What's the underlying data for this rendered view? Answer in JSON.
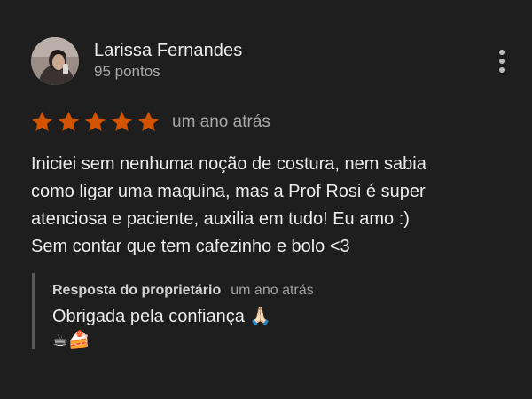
{
  "review": {
    "author": {
      "name": "Larissa Fernandes",
      "points": "95 pontos"
    },
    "rating": 5,
    "date": "um ano atrás",
    "text": "Iniciei sem nenhuma noção de costura, nem sabia\ncomo ligar uma maquina, mas a Prof Rosi é super\natenciosa e paciente, auxilia em tudo! Eu amo :)\nSem contar que tem cafezinho e bolo <3",
    "star_color": "#d35400",
    "more_icon": "more-vert-icon"
  },
  "reply": {
    "title": "Resposta do proprietário",
    "date": "um ano atrás",
    "text": "Obrigada pela confiança 🙏🏻\n☕🍰"
  }
}
